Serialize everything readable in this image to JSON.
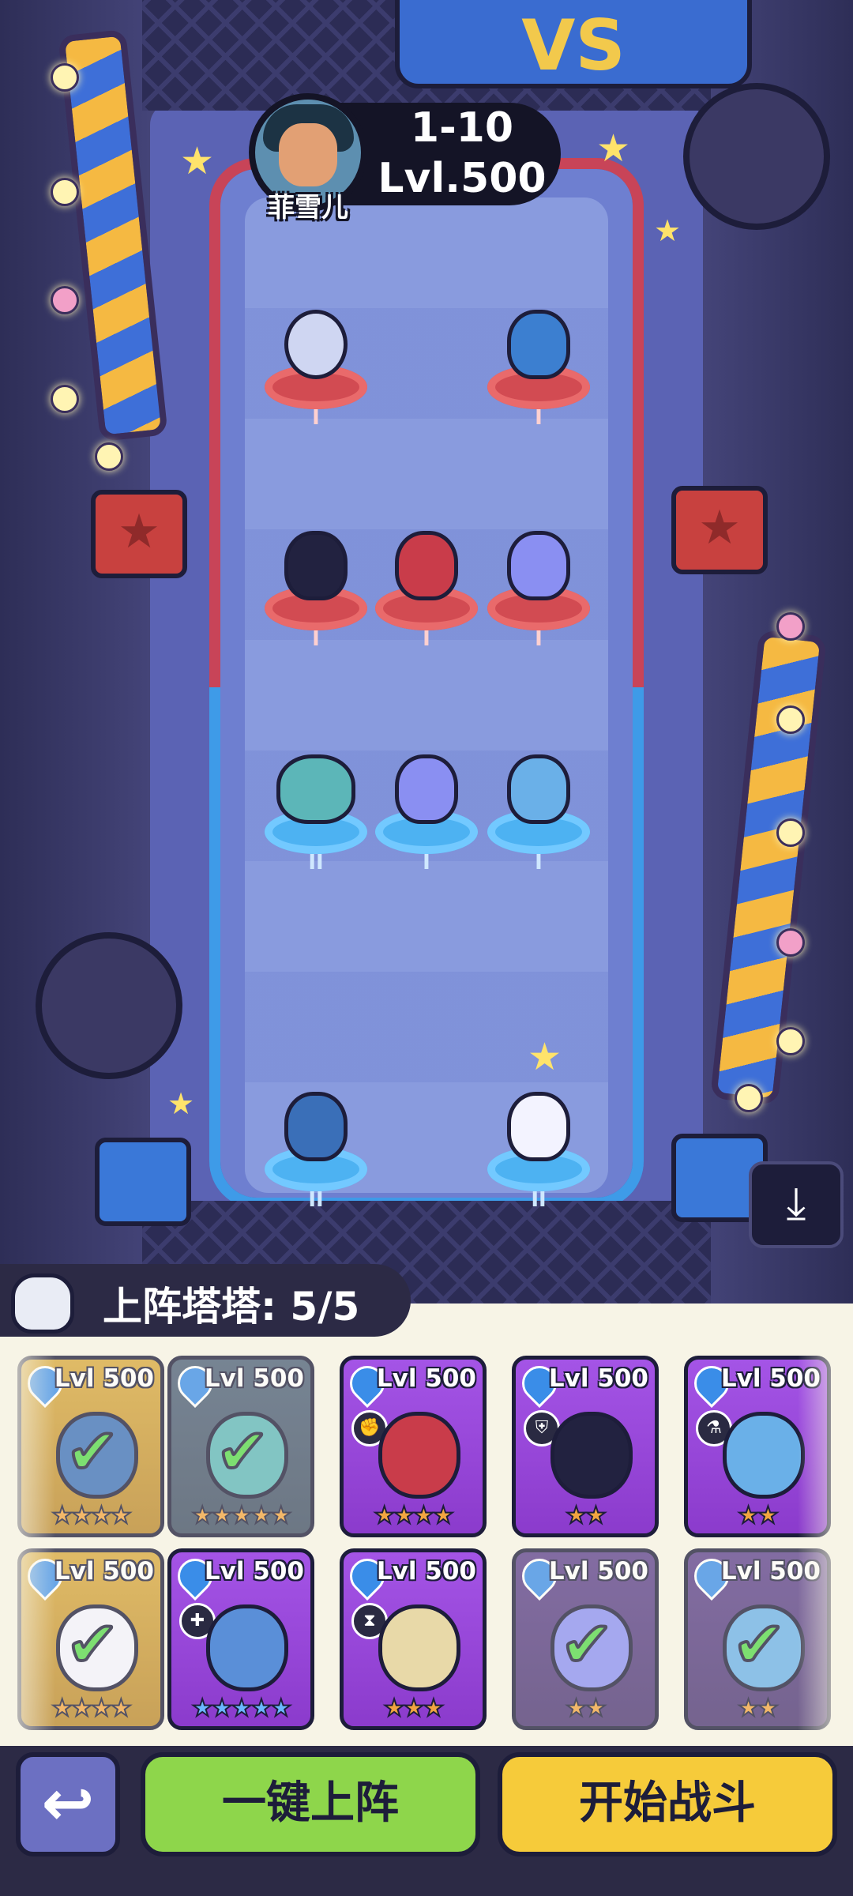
{
  "opponent": {
    "name": "菲雪儿",
    "stage": "1-10",
    "level": "Lvl.500"
  },
  "arena": {
    "vs_sign": "VS",
    "enemy_units": [
      {
        "rank": "I",
        "color": "#cfd6f2"
      },
      {
        "rank": "I",
        "color": "#3c7fd0"
      },
      {
        "rank": "I",
        "color": "#222240"
      },
      {
        "rank": "I",
        "color": "#c93c4a"
      },
      {
        "rank": "I",
        "color": "#8a8ff2"
      }
    ],
    "ally_units": [
      {
        "rank": "II",
        "color": "#5cb6b8"
      },
      {
        "rank": "I",
        "color": "#8a8ff2"
      },
      {
        "rank": "I",
        "color": "#6ab0e8"
      },
      {
        "rank": "II",
        "color": "#3a6fb8"
      },
      {
        "rank": "II",
        "color": "#f3f3ff"
      }
    ]
  },
  "roster": {
    "label": "上阵塔塔: 5/5",
    "cards": [
      {
        "level": "Lvl 500",
        "style": "gold",
        "deployed": true,
        "stars": 4,
        "star_type": "gold",
        "color": "#3a6fb8"
      },
      {
        "level": "Lvl 500",
        "style": "teal",
        "deployed": true,
        "stars": 5,
        "star_type": "gold",
        "color": "#5cb6b8"
      },
      {
        "level": "Lvl 500",
        "style": "purple",
        "deployed": false,
        "stars": 4,
        "star_type": "gold",
        "color": "#c93c4a",
        "class_icon": "✊"
      },
      {
        "level": "Lvl 500",
        "style": "purple",
        "deployed": false,
        "stars": 2,
        "star_type": "gold",
        "color": "#222240",
        "class_icon": "⛨"
      },
      {
        "level": "Lvl 500",
        "style": "purple",
        "deployed": false,
        "stars": 2,
        "star_type": "gold",
        "color": "#6ab0e8",
        "class_icon": "⚗"
      },
      {
        "level": "Lvl 500",
        "style": "gold",
        "deployed": true,
        "stars": 4,
        "star_type": "gold",
        "color": "#f3f3ff"
      },
      {
        "level": "Lvl 500",
        "style": "purple",
        "deployed": false,
        "stars": 5,
        "star_type": "blue",
        "color": "#5a8fd8",
        "class_icon": "✚"
      },
      {
        "level": "Lvl 500",
        "style": "purple",
        "deployed": false,
        "stars": 3,
        "star_type": "gold",
        "color": "#e8d9a8",
        "class_icon": "⧗"
      },
      {
        "level": "Lvl 500",
        "style": "dim",
        "deployed": true,
        "stars": 2,
        "star_type": "gold",
        "color": "#8a8ff2"
      },
      {
        "level": "Lvl 500",
        "style": "dim",
        "deployed": true,
        "stars": 2,
        "star_type": "gold",
        "color": "#6ab0e8"
      }
    ]
  },
  "buttons": {
    "back": "↩",
    "auto_deploy": "一键上阵",
    "start_battle": "开始战斗",
    "download": "⤓"
  }
}
